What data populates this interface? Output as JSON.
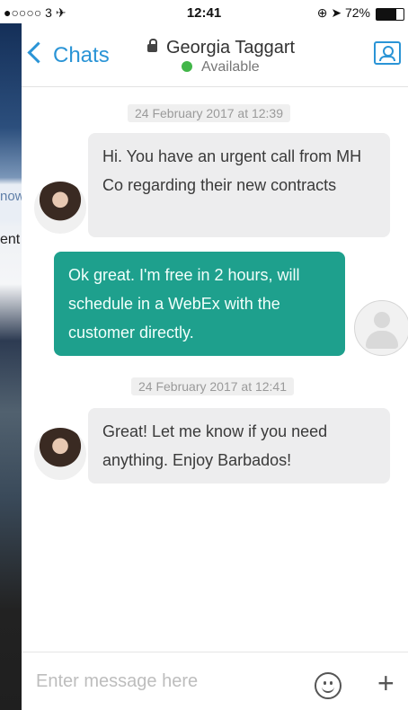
{
  "status": {
    "carrier": "●○○○○ 3 ✈",
    "time": "12:41",
    "battery_text": "⊕ ➤ 72%",
    "battery_level": 0.72
  },
  "background": {
    "left_text_1": "now",
    "left_text_2": "ent"
  },
  "header": {
    "back_label": "Chats",
    "contact_name": "Georgia Taggart",
    "contact_status": "Available",
    "status_color": "#42b649"
  },
  "conversation": {
    "timestamps": [
      "24 February 2017 at 12:39",
      "24 February 2017 at 12:41"
    ],
    "messages": [
      {
        "direction": "incoming",
        "text": "Hi. You have an urgent call from MH Co regarding their new contracts"
      },
      {
        "direction": "outgoing",
        "text": "Ok great. I'm free in 2 hours, will schedule in a WebEx with the customer directly."
      },
      {
        "direction": "incoming",
        "text": "Great! Let me know if you need anything. Enjoy Barbados!"
      }
    ]
  },
  "composer": {
    "placeholder": "Enter message here",
    "emoji_icon": "smiley-icon",
    "add_icon": "plus-icon"
  },
  "colors": {
    "accent": "#2a94d6",
    "outgoing_bubble": "#1ea08d",
    "incoming_bubble": "#ededee"
  }
}
